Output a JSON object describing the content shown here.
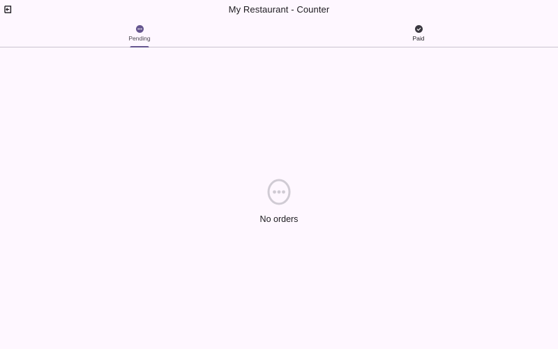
{
  "app": {
    "title": "My Restaurant - Counter"
  },
  "toolbar": {
    "exit_icon": "logout-icon"
  },
  "tabs": [
    {
      "label": "Pending",
      "icon": "more-horiz-circle-icon",
      "active": true
    },
    {
      "label": "Paid",
      "icon": "check-circle-icon",
      "active": false
    }
  ],
  "empty_state": {
    "icon": "more-horiz-circle-outline-icon",
    "message": "No orders"
  },
  "colors": {
    "background": "#fef7ff",
    "accent": "#65558f",
    "divider": "#cac4d0",
    "text": "#1d1b20",
    "muted_icon": "#d0cbd4"
  }
}
